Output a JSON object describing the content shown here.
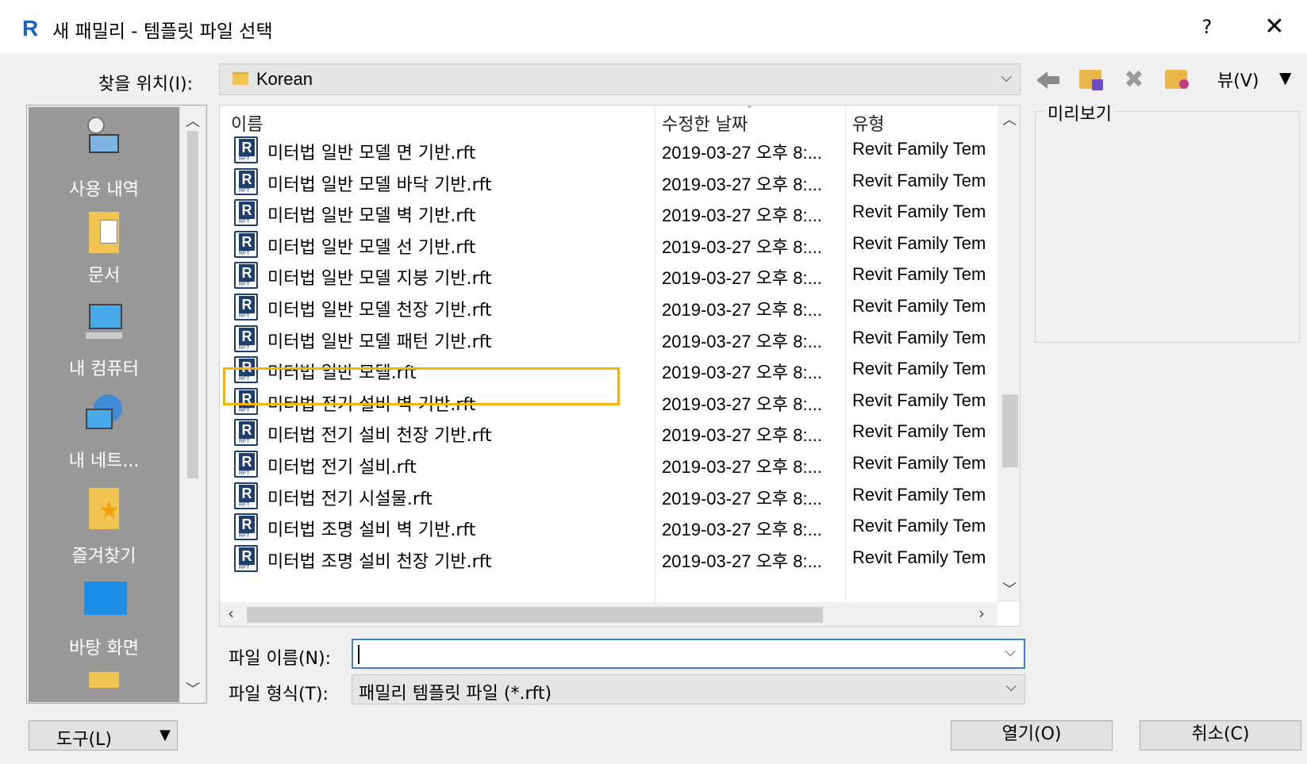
{
  "window": {
    "app_icon_letter": "R",
    "title": "새 패밀리 - 템플릿 파일 선택",
    "help_label": "?",
    "close_label": "✕"
  },
  "lookin": {
    "label": "찾을 위치(I):",
    "value": "Korean",
    "view_label": "뷰(V)"
  },
  "toolbar": {
    "back_icon": "back-icon",
    "up_icon": "up-folder-icon",
    "delete_icon": "delete-icon",
    "new_folder_icon": "new-folder-icon",
    "view_arrow": "▼"
  },
  "places": [
    {
      "label": "사용 내역",
      "icon": "history-icon"
    },
    {
      "label": "문서",
      "icon": "documents-icon"
    },
    {
      "label": "내 컴퓨터",
      "icon": "computer-icon"
    },
    {
      "label": "내 네트...",
      "icon": "network-icon"
    },
    {
      "label": "즐겨찾기",
      "icon": "favorites-icon"
    },
    {
      "label": "바탕 화면",
      "icon": "desktop-icon"
    }
  ],
  "columns": {
    "name": "이름",
    "date": "수정한 날짜",
    "type": "유형"
  },
  "files": [
    {
      "name": "미터법 일반 모델 면 기반.rft",
      "date": "2019-03-27 오후 8:...",
      "type": "Revit Family Tem"
    },
    {
      "name": "미터법 일반 모델 바닥 기반.rft",
      "date": "2019-03-27 오후 8:...",
      "type": "Revit Family Tem"
    },
    {
      "name": "미터법 일반 모델 벽 기반.rft",
      "date": "2019-03-27 오후 8:...",
      "type": "Revit Family Tem"
    },
    {
      "name": "미터법 일반 모델 선 기반.rft",
      "date": "2019-03-27 오후 8:...",
      "type": "Revit Family Tem"
    },
    {
      "name": "미터법 일반 모델 지붕 기반.rft",
      "date": "2019-03-27 오후 8:...",
      "type": "Revit Family Tem"
    },
    {
      "name": "미터법 일반 모델 천장 기반.rft",
      "date": "2019-03-27 오후 8:...",
      "type": "Revit Family Tem"
    },
    {
      "name": "미터법 일반 모델 패턴 기반.rft",
      "date": "2019-03-27 오후 8:...",
      "type": "Revit Family Tem"
    },
    {
      "name": "미터법 일반 모델.rft",
      "date": "2019-03-27 오후 8:...",
      "type": "Revit Family Tem"
    },
    {
      "name": "미터법 전기 설비 벽 기반.rft",
      "date": "2019-03-27 오후 8:...",
      "type": "Revit Family Tem"
    },
    {
      "name": "미터법 전기 설비 천장 기반.rft",
      "date": "2019-03-27 오후 8:...",
      "type": "Revit Family Tem"
    },
    {
      "name": "미터법 전기 설비.rft",
      "date": "2019-03-27 오후 8:...",
      "type": "Revit Family Tem"
    },
    {
      "name": "미터법 전기 시설물.rft",
      "date": "2019-03-27 오후 8:...",
      "type": "Revit Family Tem"
    },
    {
      "name": "미터법 조명 설비 벽 기반.rft",
      "date": "2019-03-27 오후 8:...",
      "type": "Revit Family Tem"
    },
    {
      "name": "미터법 조명 설비 천장 기반.rft",
      "date": "2019-03-27 오후 8:...",
      "type": "Revit Family Tem"
    }
  ],
  "highlighted_file": "미터법 일반 모델.rft",
  "highlight_color": "#f5b400",
  "file_icon_text": "R",
  "file_icon_subtext": "RFT",
  "preview": {
    "label": "미리보기"
  },
  "filename": {
    "label": "파일 이름(N):",
    "value": ""
  },
  "filetype": {
    "label": "파일 형식(T):",
    "value": "패밀리 템플릿 파일 (*.rft)"
  },
  "buttons": {
    "tools": "도구(L)",
    "open": "열기(O)",
    "cancel": "취소(C)"
  }
}
